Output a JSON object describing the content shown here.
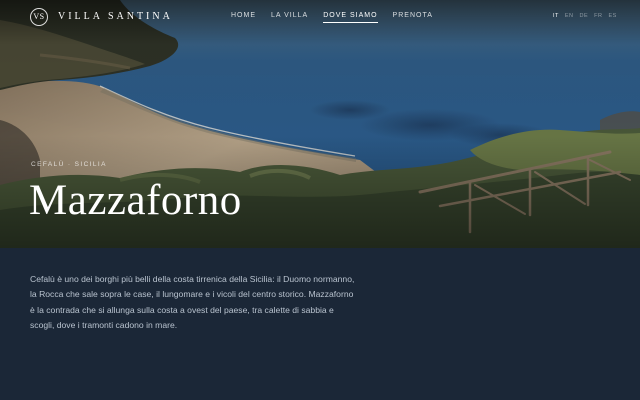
{
  "header": {
    "logo_monogram": "VS",
    "brand": "VILLA SANTINA",
    "nav": [
      {
        "label": "HOME",
        "active": false
      },
      {
        "label": "LA VILLA",
        "active": false
      },
      {
        "label": "DOVE SIAMO",
        "active": true
      },
      {
        "label": "PRENOTA",
        "active": false
      }
    ],
    "languages": [
      {
        "code": "IT",
        "active": true
      },
      {
        "code": "EN",
        "active": false
      },
      {
        "code": "DE",
        "active": false
      },
      {
        "code": "FR",
        "active": false
      },
      {
        "code": "ES",
        "active": false
      }
    ]
  },
  "hero": {
    "eyebrow": "CEFALÙ · SICILIA",
    "title": "Mazzaforno"
  },
  "content": {
    "intro": "Cefalù è uno dei borghi più belli della costa tirrenica della Sicilia: il Duomo normanno, la Rocca che sale sopra le case, il lungomare e i vicoli del centro storico. Mazzaforno è la contrada che si allunga sulla costa a ovest del paese, tra calette di sabbia e scogli, dove i tramonti cadono in mare."
  },
  "colors": {
    "page_background": "#1b2737",
    "body_text": "#b9c3cf",
    "sea": "#2b5f8f"
  }
}
